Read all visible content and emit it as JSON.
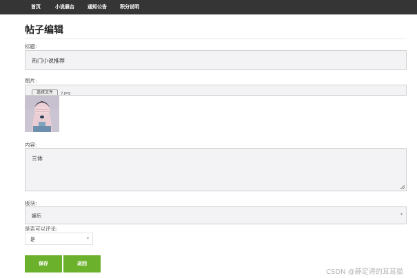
{
  "nav": {
    "items": [
      {
        "label": "首页"
      },
      {
        "label": "小说展台"
      },
      {
        "label": "通知公告"
      },
      {
        "label": "积分说明"
      }
    ]
  },
  "page": {
    "title": "帖子编辑"
  },
  "form": {
    "title_label": "标题:",
    "title_value": "热门小说推荐",
    "image_label": "图片:",
    "file_button": "选择文件",
    "file_name": "2.png",
    "content_label": "内容:",
    "content_value": "三体",
    "board_label": "板块:",
    "board_value": "娱乐",
    "comment_label": "是否可以评论:",
    "comment_value": "是",
    "save_label": "保存",
    "back_label": "返回"
  },
  "watermark": {
    "text": "CSDN @薛定谔的耳耳猫"
  },
  "colors": {
    "nav_bg": "#353535",
    "button_bg": "#6bb12b",
    "field_bg": "#f3f3f5"
  }
}
